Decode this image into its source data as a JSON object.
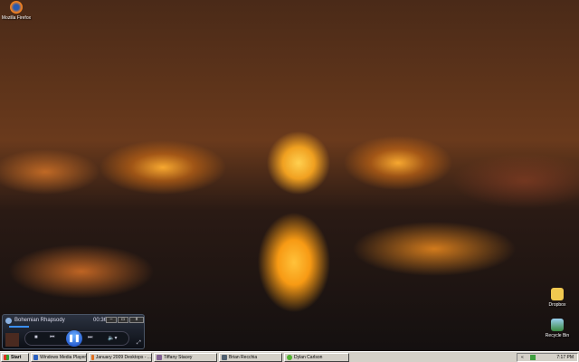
{
  "desktop": {
    "icons": [
      {
        "label": "Mozilla Firefox",
        "icon": "firefox-icon"
      },
      {
        "label": "Dropbox",
        "icon": "folder-icon"
      },
      {
        "label": "Recycle Bin",
        "icon": "recycle-bin-icon"
      }
    ]
  },
  "player": {
    "track": "Bohemian Rhapsody",
    "time": "00:36",
    "progress": 0.15,
    "minimize": "–",
    "restore": "▭",
    "close": "x",
    "stop": "■",
    "prev": "⏮",
    "pause": "❚❚",
    "next": "⏭",
    "volume": "🔈▾"
  },
  "taskbar": {
    "start": "Start",
    "items": [
      {
        "label": "Windows Media Player",
        "color": "#2a60c0"
      },
      {
        "label": "January 2009 Desktops - ...",
        "color": "#e07020"
      },
      {
        "label": "Tiffany Stacey",
        "color": "#806090"
      },
      {
        "label": "Brian Recchia",
        "color": "#506070"
      },
      {
        "label": "Dylan Carlson",
        "color": "#50b030"
      }
    ],
    "clock": "7:17 PM"
  }
}
